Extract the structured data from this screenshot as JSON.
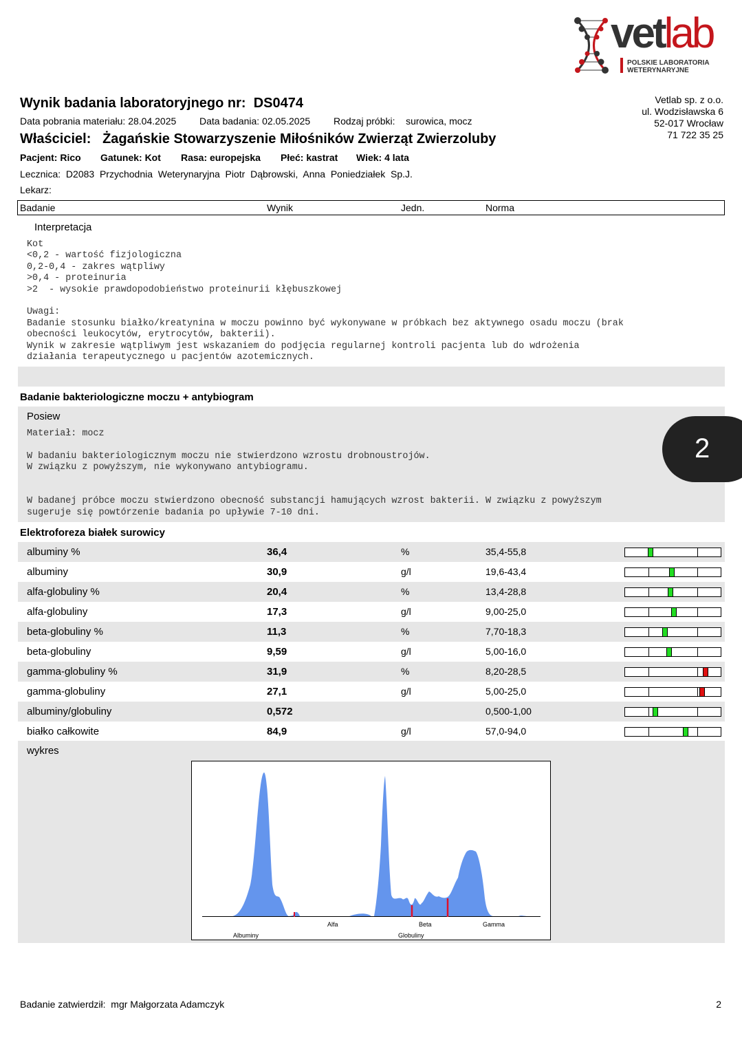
{
  "logo": {
    "brand_dark": "vet",
    "brand_red": "lab",
    "sub_line1": "POLSKIE LABORATORIA",
    "sub_line2": "WETERYNARYJNE"
  },
  "header": {
    "title_prefix": "Wynik badania laboratoryjnego nr:",
    "number": "DS0474",
    "collect_label": "Data pobrania materiału:",
    "collect_date": "28.04.2025",
    "exam_label": "Data badania:",
    "exam_date": "02.05.2025",
    "sample_label": "Rodzaj próbki:",
    "sample": "surowica, mocz",
    "owner_label": "Właściciel:",
    "owner": "Żagańskie Stowarzyszenie Miłośników Zwierząt Zwierzoluby",
    "patient": "Pacjent: Rico",
    "species": "Gatunek: Kot",
    "breed": "Rasa: europejska",
    "sex": "Płeć: kastrat",
    "age": "Wiek: 4 lata",
    "clinic": "Lecznica:  D2083  Przychodnia  Weterynaryjna  Piotr  Dąbrowski,  Anna  Poniedziałek  Sp.J.",
    "doctor": "Lekarz:"
  },
  "company": {
    "name": "Vetlab sp. z o.o.",
    "street": "ul. Wodzisławska 6",
    "city": "52-017 Wrocław",
    "phone": "71 722 35 25"
  },
  "table_header": {
    "test": "Badanie",
    "result": "Wynik",
    "unit": "Jedn.",
    "norm": "Norma"
  },
  "interpretation": {
    "title": "Interpretacja",
    "body": "Kot\n<0,2 - wartość fizjologiczna\n0,2-0,4 - zakres wątpliwy\n>0,4 - proteinuria\n>2  - wysokie prawdopodobieństwo proteinurii kłębuszkowej\n\nUwagi:\nBadanie stosunku białko/kreatynina w moczu powinno być wykonywane w próbkach bez aktywnego osadu moczu (brak\nobecności leukocytów, erytrocytów, bakterii).\nWynik w zakresie wątpliwym jest wskazaniem do podjęcia regularnej kontroli pacjenta lub do wdrożenia\ndziałania terapeutycznego u pacjentów azotemicznych."
  },
  "bacteriology": {
    "section_title": "Badanie bakteriologiczne moczu + antybiogram",
    "subtitle": "Posiew",
    "body": "Materiał: mocz\n\nW badaniu bakteriologicznym moczu nie stwierdzono wzrostu drobnoustrojów.\nW związku z powyższym, nie wykonywano antybiogramu.\n\n\nW badanej próbce moczu stwierdzono obecność substancji hamujących wzrost bakterii. W związku z powyższym\nsugeruje się powtórzenie badania po upływie 7-10 dni."
  },
  "page_badge": "2",
  "electrophoresis": {
    "section_title": "Elektroforeza białek surowicy",
    "rows": [
      {
        "name": "albuminy %",
        "result": "36,4",
        "unit": "%",
        "norm": "35,4-55,8",
        "value": 36.4,
        "low": 35.4,
        "high": 55.8,
        "status": "normal"
      },
      {
        "name": "albuminy",
        "result": "30,9",
        "unit": "g/l",
        "norm": "19,6-43,4",
        "value": 30.9,
        "low": 19.6,
        "high": 43.4,
        "status": "normal"
      },
      {
        "name": "alfa-globuliny %",
        "result": "20,4",
        "unit": "%",
        "norm": "13,4-28,8",
        "value": 20.4,
        "low": 13.4,
        "high": 28.8,
        "status": "normal"
      },
      {
        "name": "alfa-globuliny",
        "result": "17,3",
        "unit": "g/l",
        "norm": "9,00-25,0",
        "value": 17.3,
        "low": 9.0,
        "high": 25.0,
        "status": "normal"
      },
      {
        "name": "beta-globuliny %",
        "result": "11,3",
        "unit": "%",
        "norm": "7,70-18,3",
        "value": 11.3,
        "low": 7.7,
        "high": 18.3,
        "status": "normal"
      },
      {
        "name": "beta-globuliny",
        "result": "9,59",
        "unit": "g/l",
        "norm": "5,00-16,0",
        "value": 9.59,
        "low": 5.0,
        "high": 16.0,
        "status": "normal"
      },
      {
        "name": "gamma-globuliny %",
        "result": "31,9",
        "unit": "%",
        "norm": "8,20-28,5",
        "value": 31.9,
        "low": 8.2,
        "high": 28.5,
        "status": "high"
      },
      {
        "name": "gamma-globuliny",
        "result": "27,1",
        "unit": "g/l",
        "norm": "5,00-25,0",
        "value": 27.1,
        "low": 5.0,
        "high": 25.0,
        "status": "high"
      },
      {
        "name": "albuminy/globuliny",
        "result": "0,572",
        "unit": "",
        "norm": "0,500-1,00",
        "value": 0.572,
        "low": 0.5,
        "high": 1.0,
        "status": "normal"
      },
      {
        "name": "białko całkowite",
        "result": "84,9",
        "unit": "g/l",
        "norm": "57,0-94,0",
        "value": 84.9,
        "low": 57.0,
        "high": 94.0,
        "status": "normal"
      }
    ],
    "colors": {
      "normal": "#22dd22",
      "high": "#e01010",
      "curve": "#6495ed",
      "divider": "#e0102a"
    },
    "chart_title": "wykres",
    "axis_labels": {
      "albuminy": "Albuminy",
      "alfa": "Alfa",
      "globuliny": "Globuliny",
      "beta": "Beta",
      "gamma": "Gamma"
    }
  },
  "footer": {
    "approved": "Badanie zatwierdził:  mgr Małgorzata Adamczyk",
    "page": "2"
  }
}
